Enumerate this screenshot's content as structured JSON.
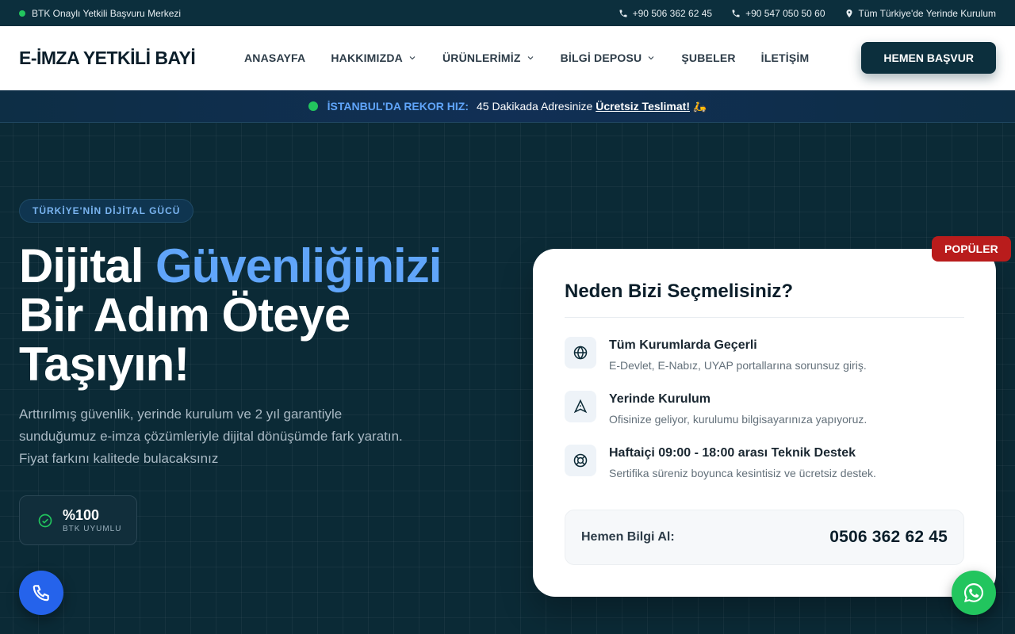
{
  "topbar": {
    "left_text": "BTK Onaylı Yetkili Başvuru Merkezi",
    "phone1": "+90 506 362 62 45",
    "phone2": "+90 547 050 50 60",
    "location": "Tüm Türkiye'de Yerinde Kurulum"
  },
  "nav": {
    "logo": "E-İMZA YETKİLİ BAYİ",
    "items": [
      {
        "label": "ANASAYFA",
        "dropdown": false
      },
      {
        "label": "HAKKIMIZDA",
        "dropdown": true
      },
      {
        "label": "ÜRÜNLERİMİZ",
        "dropdown": true
      },
      {
        "label": "BİLGİ DEPOSU",
        "dropdown": true
      },
      {
        "label": "ŞUBELER",
        "dropdown": false
      },
      {
        "label": "İLETİŞİM",
        "dropdown": false
      }
    ],
    "cta": "HEMEN BAŞVUR"
  },
  "announce": {
    "highlight": "İSTANBUL'DA REKOR HIZ:",
    "text": "45 Dakikada Adresinize",
    "underlined": "Ücretsiz Teslimat!",
    "emoji": "🛵"
  },
  "hero": {
    "badge": "TÜRKİYE'NİN DİJİTAL GÜCÜ",
    "title_part1": "Dijital ",
    "title_highlight": "Güvenliğinizi",
    "title_part2": "Bir Adım Öteye Taşıyın!",
    "description": "Arttırılmış güvenlik, yerinde kurulum ve 2 yıl garantiyle sunduğumuz e-imza çözümleriyle dijital dönüşümde fark yaratın. Fiyat farkını kalitede bulacaksınız",
    "stat_value": "%100",
    "stat_label": "BTK UYUMLU"
  },
  "card": {
    "badge": "POPÜLER",
    "title": "Neden Bizi Seçmelisiniz?",
    "features": [
      {
        "icon": "globe-icon",
        "title": "Tüm Kurumlarda Geçerli",
        "desc": "E-Devlet, E-Nabız, UYAP portallarına sorunsuz giriş."
      },
      {
        "icon": "navigation-icon",
        "title": "Yerinde Kurulum",
        "desc": "Ofisinize geliyor, kurulumu bilgisayarınıza yapıyoruz."
      },
      {
        "icon": "lifebuoy-icon",
        "title": "Haftaiçi 09:00 - 18:00 arası Teknik Destek",
        "desc": "Sertifika süreniz boyunca kesintisiz ve ücretsiz destek."
      }
    ],
    "info_label": "Hemen Bilgi Al:",
    "info_phone": "0506 362 62 45"
  },
  "colors": {
    "primary_dark": "#0c2f3d",
    "accent_blue": "#60a5fa",
    "popular_red": "#b91c1c",
    "whatsapp_green": "#22c55e",
    "call_blue": "#2563eb"
  }
}
